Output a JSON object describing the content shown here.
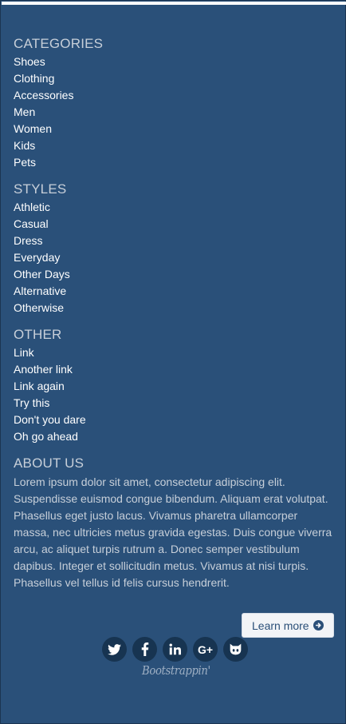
{
  "sections": {
    "categories": {
      "title": "CATEGORIES",
      "items": [
        "Shoes",
        "Clothing",
        "Accessories",
        "Men",
        "Women",
        "Kids",
        "Pets"
      ]
    },
    "styles": {
      "title": "STYLES",
      "items": [
        "Athletic",
        "Casual",
        "Dress",
        "Everyday",
        "Other Days",
        "Alternative",
        "Otherwise"
      ]
    },
    "other": {
      "title": "OTHER",
      "items": [
        "Link",
        "Another link",
        "Link again",
        "Try this",
        "Don't you dare",
        "Oh go ahead"
      ]
    }
  },
  "about": {
    "title": "ABOUT US",
    "text": "Lorem ipsum dolor sit amet, consectetur adipiscing elit. Suspendisse euismod congue bibendum. Aliquam erat volutpat. Phasellus eget justo lacus. Vivamus pharetra ullamcorper massa, nec ultricies metus gravida egestas. Duis congue viverra arcu, ac aliquet turpis rutrum a. Donec semper vestibulum dapibus. Integer et sollicitudin metus. Vivamus at nisi turpis. Phasellus vel tellus id felis cursus hendrerit."
  },
  "learn_more": {
    "label": "Learn more",
    "icon": "arrow-circle-right-icon"
  },
  "social": {
    "icons": [
      "twitter-icon",
      "facebook-icon",
      "linkedin-icon",
      "google-plus-icon",
      "github-icon"
    ],
    "google_plus_label": "G+"
  },
  "brand": "Bootstrappin'",
  "colors": {
    "background": "#2a5079",
    "link": "#ffffff",
    "heading": "#c7cfd9",
    "social_circle": "#173451"
  }
}
